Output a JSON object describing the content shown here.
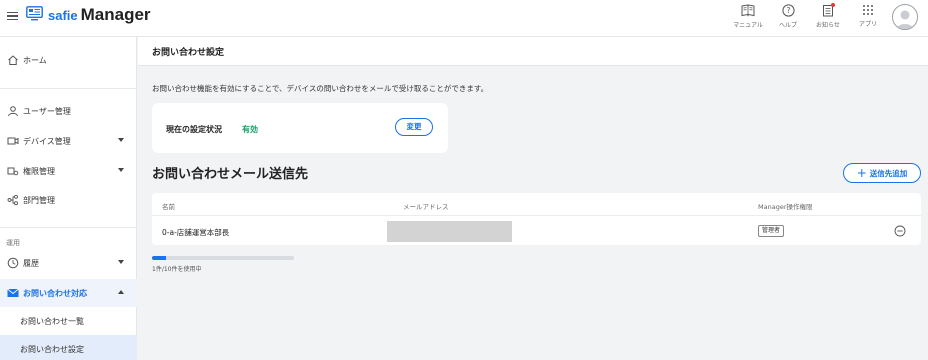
{
  "header": {
    "brand_small": "safie",
    "brand_big": "Manager",
    "icons": [
      {
        "name": "manual-icon",
        "label": "マニュアル"
      },
      {
        "name": "help-icon",
        "label": "ヘルプ"
      },
      {
        "name": "notice-icon",
        "label": "お知らせ"
      },
      {
        "name": "apps-icon",
        "label": "アプリ"
      }
    ]
  },
  "sidebar": {
    "home": "ホーム",
    "user_mgmt": "ユーザー管理",
    "device_mgmt": "デバイス管理",
    "permission_mgmt": "権限管理",
    "dept_mgmt": "部門管理",
    "section_ops": "運用",
    "history": "履歴",
    "inquiry_handling": "お問い合わせ対応",
    "inquiry_list": "お問い合わせ一覧",
    "inquiry_settings": "お問い合わせ設定"
  },
  "main": {
    "page_title": "お問い合わせ設定",
    "description": "お問い合わせ機能を有効にすることで、デバイスの問い合わせをメールで受け取ることができます。",
    "status_label": "現在の設定状況",
    "status_value": "有効",
    "change_button": "変更",
    "recipients_title": "お問い合わせメール送信先",
    "add_button": "送信先追加",
    "table": {
      "col_name": "名前",
      "col_email": "メールアドレス",
      "col_permission": "Manager操作権限",
      "rows": [
        {
          "name": "0-a-店舗運営本部長",
          "permission": "管理者"
        }
      ]
    },
    "usage_text": "1件/10件を使用中",
    "usage_fraction": 0.1
  },
  "colors": {
    "accent": "#1a73e8",
    "status_enabled": "#1a9e6b"
  }
}
